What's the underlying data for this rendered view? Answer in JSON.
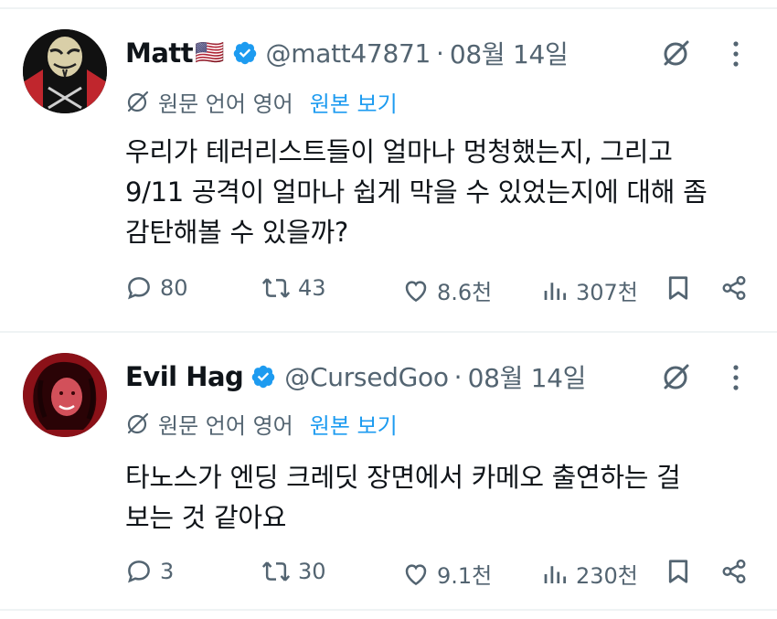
{
  "tweets": [
    {
      "name": "Matt",
      "flag": "🇺🇸",
      "handle": "@matt47871",
      "dot": "·",
      "date": "08월 14일",
      "translate_label": "원문 언어 영어",
      "translate_link": "원본 보기",
      "text_lines": [
        "우리가 테러리스트들이 얼마나 멍청했는지, 그리고",
        "9/11 공격이 얼마나 쉽게 막을 수 있었는지에 대해 좀",
        "감탄해볼 수 있을까?"
      ],
      "replies": "80",
      "retweets": "43",
      "likes": "8.6천",
      "views": "307천",
      "avatar": "guy-fawkes-mask-avatar"
    },
    {
      "name": "Evil Hag",
      "handle": "@CursedGoo",
      "dot": "·",
      "date": "08월 14일",
      "translate_label": "원문 언어 영어",
      "translate_link": "원본 보기",
      "text_lines": [
        "타노스가 엔딩 크레딧 장면에서 카메오 출연하는 걸",
        "보는 것 같아요"
      ],
      "replies": "3",
      "retweets": "30",
      "likes": "9.1천",
      "views": "230천",
      "avatar": "red-portrait-avatar"
    }
  ],
  "colors": {
    "text": "#0f1419",
    "muted": "#536471",
    "link": "#1d9bf0",
    "verified": "#1d9bf0",
    "divider": "#eff3f4"
  }
}
